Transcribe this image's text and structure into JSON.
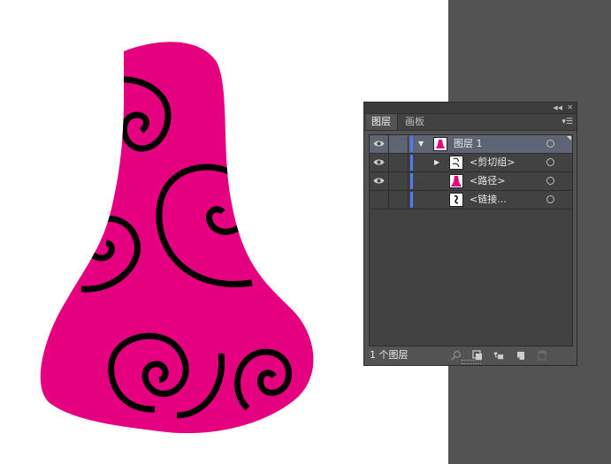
{
  "panel": {
    "collapse_icon": "double-chevron-left-icon",
    "close_icon": "close-icon",
    "tabs": [
      {
        "label": "图层",
        "active": true
      },
      {
        "label": "画板",
        "active": false
      }
    ],
    "menu_icon": "panel-menu-icon",
    "layers": [
      {
        "label": "图层 1",
        "visible": true,
        "expanded": true,
        "selected": true,
        "thumb": "layer-thumbnail"
      },
      {
        "label": "<剪切组>",
        "visible": true,
        "expanded": false,
        "selected": false,
        "thumb": "clip-group-thumbnail"
      },
      {
        "label": "<路径>",
        "visible": true,
        "selected": false,
        "thumb": "path-thumbnail"
      },
      {
        "label": "<链接...",
        "visible": false,
        "selected": false,
        "thumb": "linked-image-thumbnail"
      }
    ],
    "footer": {
      "count_label": "1 个图层",
      "buttons": [
        "locate-object-icon",
        "make-clipping-mask-icon",
        "create-sublayer-icon",
        "new-layer-icon",
        "trash-icon"
      ]
    }
  },
  "colors": {
    "artwork_fill": "#e4007f",
    "swirl": "#000000",
    "pasteboard": "#535353",
    "layer_color": "#4f7cff"
  }
}
